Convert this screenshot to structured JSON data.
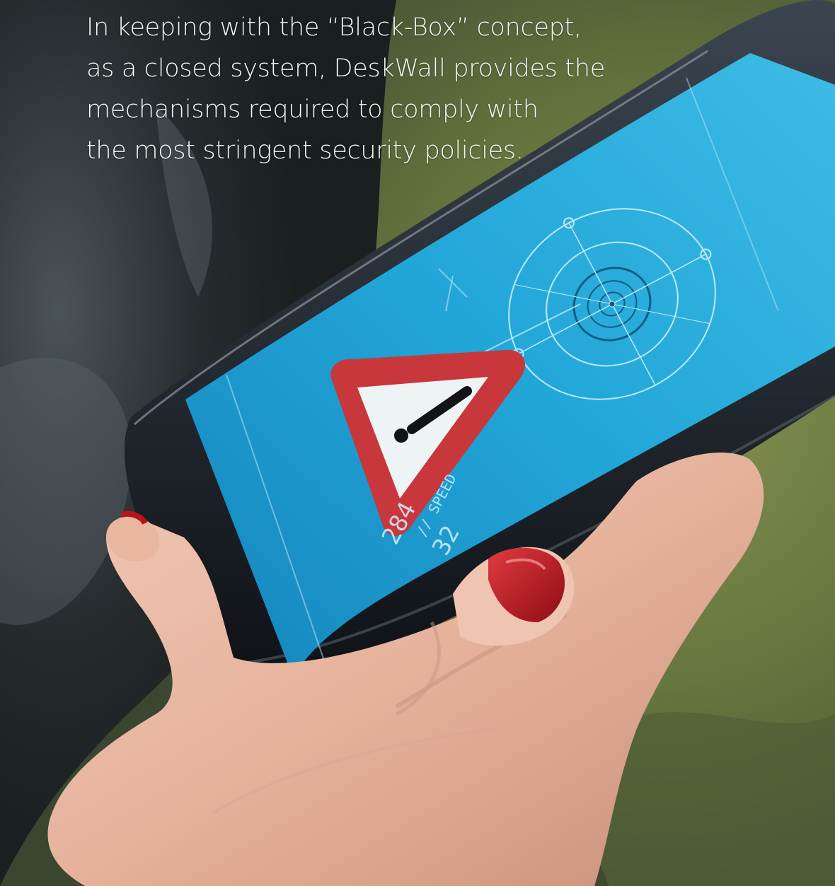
{
  "caption": {
    "lines": [
      "In keeping with the “Black-Box” concept,",
      "as a closed system, DeskWall provides the",
      "mechanisms required to comply with",
      "the most stringent security policies."
    ]
  },
  "photo": {
    "subject": "hand holding smartphone showing warning sign",
    "icons": [
      "warning-triangle-icon",
      "radar-icon"
    ]
  },
  "screen": {
    "speed_label": "// SPEED",
    "value_1": "32",
    "value_2": "284"
  },
  "colors": {
    "screen": "#1d9fd3",
    "warning_red": "#c8373b",
    "nail_red": "#b8141d",
    "background_green": "#6e7d4a"
  }
}
